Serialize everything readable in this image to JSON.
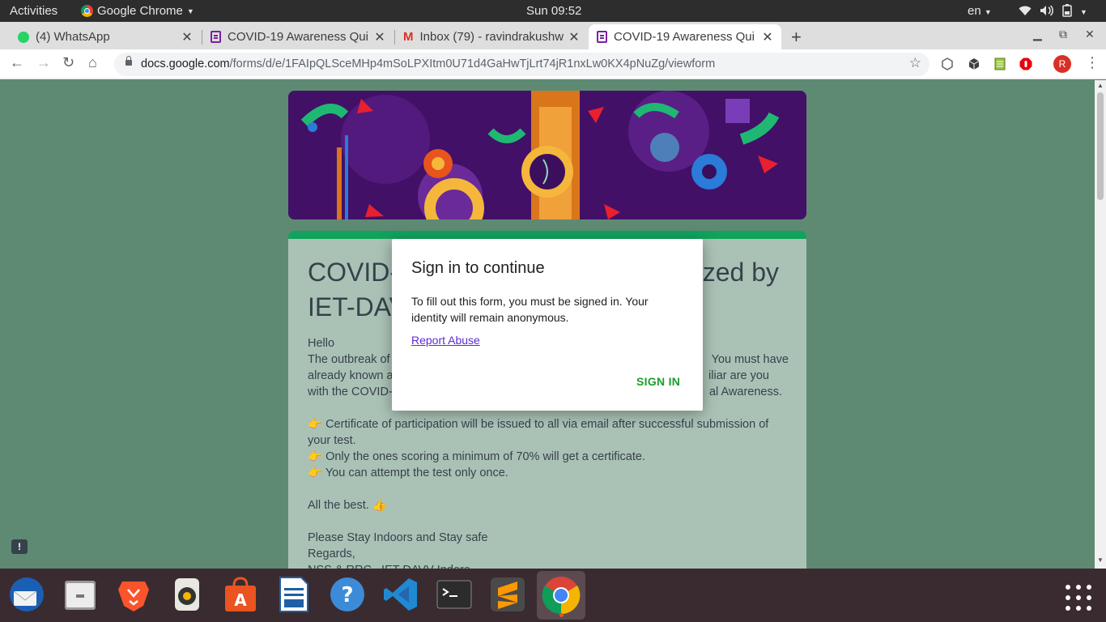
{
  "topbar": {
    "activities": "Activities",
    "app_name": "Google Chrome",
    "clock": "Sun 09:52",
    "lang": "en"
  },
  "tabs": [
    {
      "title": "(4) WhatsApp",
      "favicon": "whatsapp-icon"
    },
    {
      "title": "COVID-19 Awareness Qui",
      "favicon": "forms-icon"
    },
    {
      "title": "Inbox (79) - ravindrakushw",
      "favicon": "gmail-icon"
    },
    {
      "title": "COVID-19 Awareness Qui",
      "favicon": "forms-icon",
      "active": true
    }
  ],
  "omnibox": {
    "host": "docs.google.com",
    "path": "/forms/d/e/1FAIpQLSceMHp4mSoLPXItm0U71d4GaHwTjLrt74jR1nxLw0KX4pNuZg/viewform"
  },
  "profile_initial": "R",
  "form": {
    "title_left": "COVID-",
    "title_right": "zed by",
    "title_line2": "IET-DAV",
    "desc": {
      "hello": "Hello",
      "line1_left": "The outbreak of",
      "line1_right": "You must have",
      "line2_left": "already known a",
      "line2_right": "iliar are you",
      "line3_left": "with the COVID-1",
      "line3_right": "al Awareness.",
      "bullet1": "👉 Certificate of participation will be issued to all via email after successful submission of your test.",
      "bullet2": "👉 Only the ones scoring a minimum of 70% will get a certificate.",
      "bullet3": "👉 You can attempt the test only once.",
      "best": "All the best. 👍",
      "stay": "Please Stay Indoors and Stay safe",
      "regards": "Regards,",
      "org": "NSS & RRC,  IET DAVV Indore"
    }
  },
  "dialog": {
    "title": "Sign in to continue",
    "body": "To fill out this form, you must be signed in. Your identity will remain anonymous.",
    "report_abuse": "Report Abuse",
    "signin": "SIGN IN"
  },
  "colors": {
    "page_bg": "#5e8a74",
    "form_accent": "#10a35c",
    "signin_green": "#1a9e2a",
    "link_purple": "#5c2bd6"
  }
}
